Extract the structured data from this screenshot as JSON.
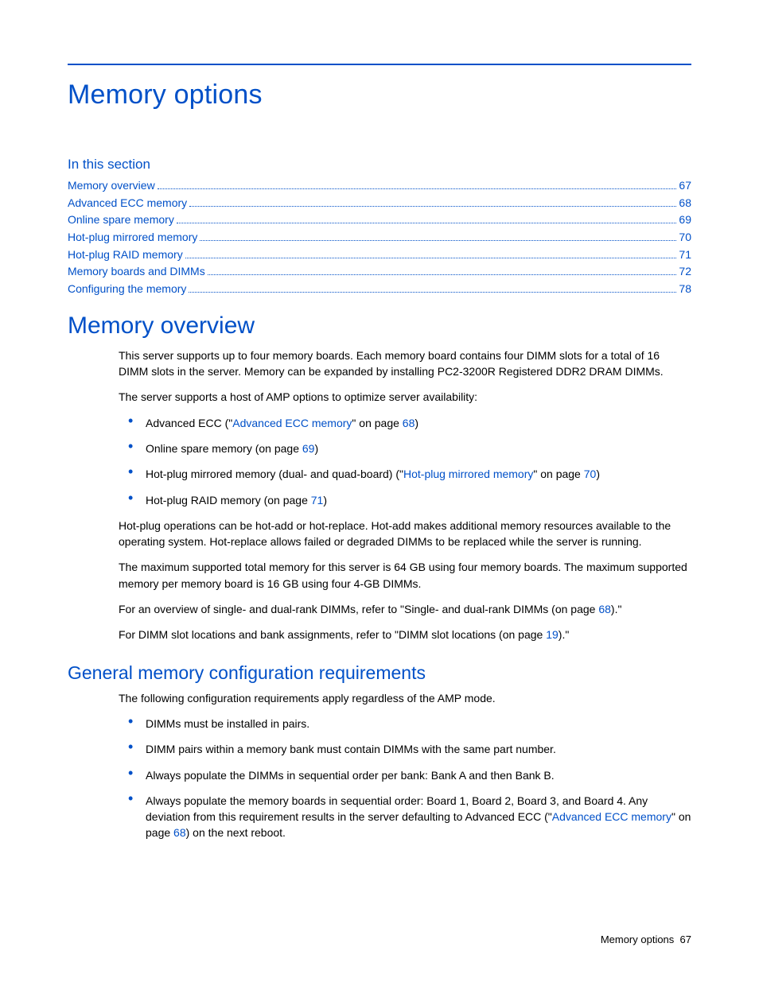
{
  "page_title": "Memory options",
  "section_label": "In this section",
  "toc": [
    {
      "label": "Memory overview",
      "page": "67"
    },
    {
      "label": "Advanced ECC memory",
      "page": "68"
    },
    {
      "label": "Online spare memory",
      "page": "69"
    },
    {
      "label": "Hot-plug mirrored memory",
      "page": "70"
    },
    {
      "label": "Hot-plug RAID memory",
      "page": "71"
    },
    {
      "label": "Memory boards and DIMMs",
      "page": "72"
    },
    {
      "label": "Configuring the memory",
      "page": "78"
    }
  ],
  "overview": {
    "heading": "Memory overview",
    "p1": "This server supports up to four memory boards. Each memory board contains four DIMM slots for a total of 16 DIMM slots in the server. Memory can be expanded by installing PC2-3200R Registered DDR2 DRAM DIMMs.",
    "p2": "The server supports a host of AMP options to optimize server availability:",
    "bullets": {
      "b1_pre": "Advanced ECC (\"",
      "b1_link": "Advanced ECC memory",
      "b1_mid": "\" on page ",
      "b1_page": "68",
      "b1_post": ")",
      "b2_pre": "Online spare memory (on page ",
      "b2_page": "69",
      "b2_post": ")",
      "b3_pre": "Hot-plug mirrored memory (dual- and quad-board) (\"",
      "b3_link": "Hot-plug mirrored memory",
      "b3_mid": "\" on page ",
      "b3_page": "70",
      "b3_post": ")",
      "b4_pre": "Hot-plug RAID memory (on page ",
      "b4_page": "71",
      "b4_post": ")"
    },
    "p3": "Hot-plug operations can be hot-add or hot-replace. Hot-add makes additional memory resources available to the operating system. Hot-replace allows failed or degraded DIMMs to be replaced while the server is running.",
    "p4": "The maximum supported total memory for this server is 64 GB using four memory boards. The maximum supported memory per memory board is 16 GB using four 4-GB DIMMs.",
    "p5_pre": "For an overview of single- and dual-rank DIMMs, refer to \"Single- and dual-rank DIMMs (on page ",
    "p5_page": "68",
    "p5_post": ").\"",
    "p6_pre": "For DIMM slot locations and bank assignments, refer to \"DIMM slot locations (on page ",
    "p6_page": "19",
    "p6_post": ").\""
  },
  "general": {
    "heading": "General memory configuration requirements",
    "intro": "The following configuration requirements apply regardless of the AMP mode.",
    "b1": "DIMMs must be installed in pairs.",
    "b2": "DIMM pairs within a memory bank must contain DIMMs with the same part number.",
    "b3": "Always populate the DIMMs in sequential order per bank: Bank A and then Bank B.",
    "b4_pre": "Always populate the memory boards in sequential order: Board 1, Board 2, Board 3, and Board 4. Any deviation from this requirement results in the server defaulting to Advanced ECC (\"",
    "b4_link": "Advanced ECC memory",
    "b4_mid": "\" on page ",
    "b4_page": "68",
    "b4_post": ") on the next reboot."
  },
  "footer": {
    "label": "Memory options",
    "page": "67"
  }
}
